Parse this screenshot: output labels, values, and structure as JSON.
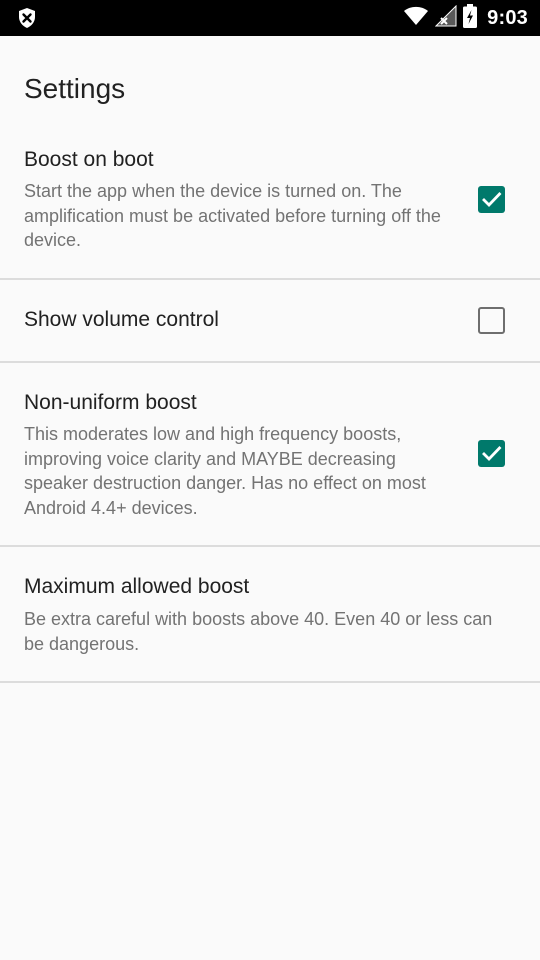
{
  "status_bar": {
    "time": "9:03",
    "icons": [
      "shield-close-icon",
      "wifi-icon",
      "signal-icon",
      "battery-charging-icon"
    ]
  },
  "page": {
    "title": "Settings"
  },
  "preferences": [
    {
      "title": "Boost on boot",
      "summary": "Start the app when the device is turned on. The amplification must be activated before turning off the device.",
      "checked": true
    },
    {
      "title": "Show volume control",
      "summary": "",
      "checked": false
    },
    {
      "title": "Non-uniform boost",
      "summary": "This moderates low and high frequency boosts, improving voice clarity and MAYBE decreasing speaker destruction danger. Has no effect on most Android 4.4+ devices.",
      "checked": true
    },
    {
      "title": "Maximum allowed boost",
      "summary": "Be extra careful with boosts above 40. Even 40 or less can be dangerous."
    }
  ],
  "colors": {
    "accent": "#00796b",
    "background": "#fafafa",
    "status_bar": "#000000",
    "title_text": "#212121",
    "summary_text": "#737373",
    "divider": "#dcdcdc"
  }
}
